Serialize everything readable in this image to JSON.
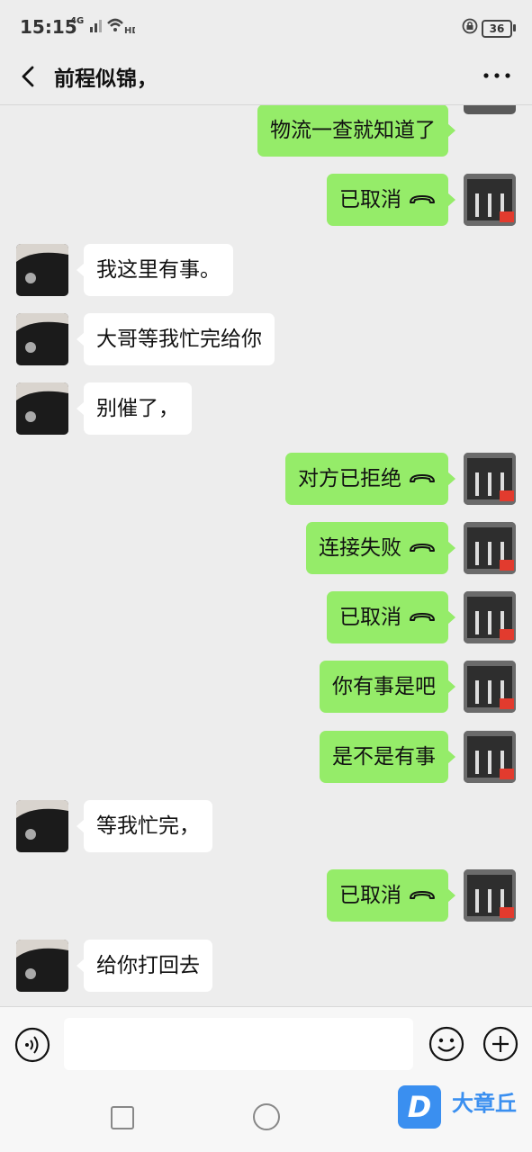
{
  "status_bar": {
    "time": "15:15",
    "network": "4G",
    "battery": "36"
  },
  "header": {
    "title": "前程似锦，"
  },
  "messages": [
    {
      "side": "me",
      "text": "物流一查就知道了",
      "call": false
    },
    {
      "side": "me",
      "text": "已取消",
      "call": true
    },
    {
      "side": "them",
      "text": "我这里有事。",
      "call": false
    },
    {
      "side": "them",
      "text": "大哥等我忙完给你",
      "call": false
    },
    {
      "side": "them",
      "text": "别催了，",
      "call": false
    },
    {
      "side": "me",
      "text": "对方已拒绝",
      "call": true
    },
    {
      "side": "me",
      "text": "连接失败",
      "call": true
    },
    {
      "side": "me",
      "text": "已取消",
      "call": true
    },
    {
      "side": "me",
      "text": "你有事是吧",
      "call": false
    },
    {
      "side": "me",
      "text": "是不是有事",
      "call": false
    },
    {
      "side": "them",
      "text": "等我忙完，",
      "call": false
    },
    {
      "side": "me",
      "text": "已取消",
      "call": true
    },
    {
      "side": "them",
      "text": "给你打回去",
      "call": false
    }
  ],
  "input": {
    "placeholder": ""
  },
  "watermark": {
    "brand": "大章丘",
    "logo_letter": "D"
  },
  "colors": {
    "background": "#ededed",
    "my_bubble": "#95ec69",
    "their_bubble": "#ffffff"
  },
  "icons": [
    "back-arrow-icon",
    "more-icon",
    "voice-icon",
    "emoji-icon",
    "plus-icon",
    "call-hangup-icon"
  ]
}
